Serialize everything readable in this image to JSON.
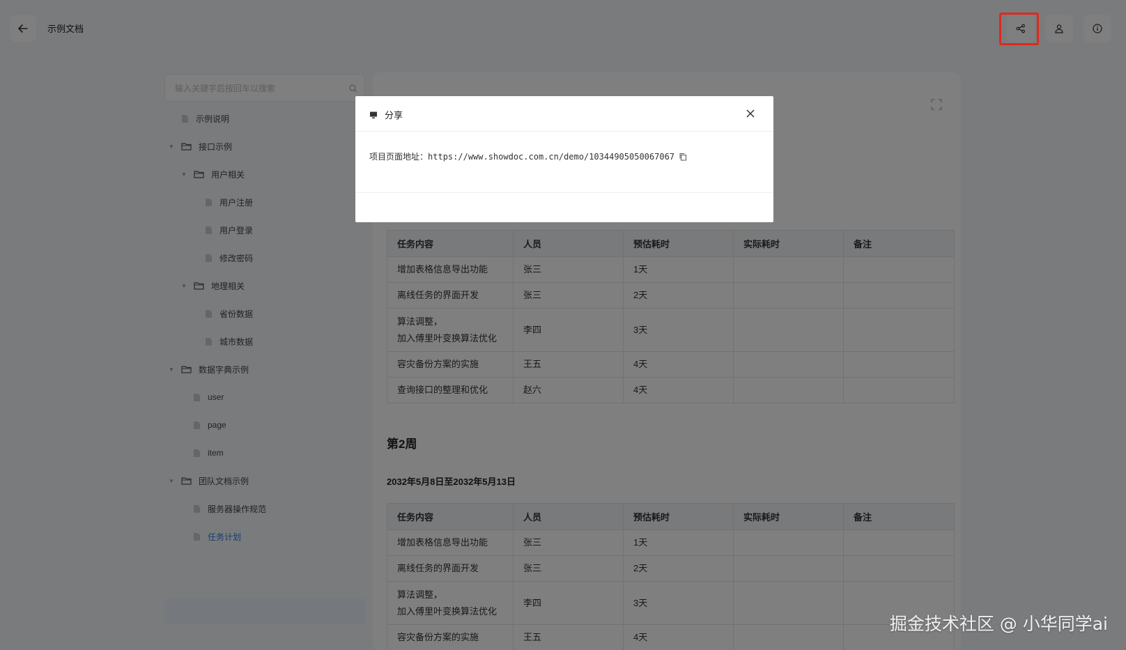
{
  "header": {
    "title": "示例文档",
    "back_icon": "arrow-left-icon",
    "share_icon": "share-icon",
    "user_icon": "user-icon",
    "info_icon": "info-icon"
  },
  "sidebar": {
    "search_placeholder": "输入关键字后按回车以搜索",
    "items": [
      {
        "label": "示例说明",
        "type": "file",
        "level": 0
      },
      {
        "label": "接口示例",
        "type": "folder",
        "level": 0,
        "expanded": true
      },
      {
        "label": "用户相关",
        "type": "folder",
        "level": 1,
        "expanded": true
      },
      {
        "label": "用户注册",
        "type": "file",
        "level": 2
      },
      {
        "label": "用户登录",
        "type": "file",
        "level": 2
      },
      {
        "label": "修改密码",
        "type": "file",
        "level": 2
      },
      {
        "label": "地理相关",
        "type": "folder",
        "level": 1,
        "expanded": true
      },
      {
        "label": "省份数据",
        "type": "file",
        "level": 2
      },
      {
        "label": "城市数据",
        "type": "file",
        "level": 2
      },
      {
        "label": "数据字典示例",
        "type": "folder",
        "level": 0,
        "expanded": true
      },
      {
        "label": "user",
        "type": "file",
        "level": 1
      },
      {
        "label": "page",
        "type": "file",
        "level": 1
      },
      {
        "label": "item",
        "type": "file",
        "level": 1
      },
      {
        "label": "团队文档示例",
        "type": "folder",
        "level": 0,
        "expanded": true
      },
      {
        "label": "服务器操作规范",
        "type": "file",
        "level": 1
      },
      {
        "label": "任务计划",
        "type": "file",
        "level": 1,
        "active": true
      }
    ]
  },
  "main": {
    "table_headers": [
      "任务内容",
      "人员",
      "预估耗时",
      "实际耗时",
      "备注"
    ],
    "week1_rows": [
      [
        "增加表格信息导出功能",
        "张三",
        "1天",
        "",
        ""
      ],
      [
        "离线任务的界面开发",
        "张三",
        "2天",
        "",
        ""
      ],
      [
        "算法调整，\n加入傅里叶变换算法优化",
        "李四",
        "3天",
        "",
        ""
      ],
      [
        "容灾备份方案的实施",
        "王五",
        "4天",
        "",
        ""
      ],
      [
        "查询接口的整理和优化",
        "赵六",
        "4天",
        "",
        ""
      ]
    ],
    "week2_heading": "第2周",
    "week2_range": "2032年5月8日至2032年5月13日",
    "week2_rows": [
      [
        "增加表格信息导出功能",
        "张三",
        "1天",
        "",
        ""
      ],
      [
        "离线任务的界面开发",
        "张三",
        "2天",
        "",
        ""
      ],
      [
        "算法调整，\n加入傅里叶变换算法优化",
        "李四",
        "3天",
        "",
        ""
      ],
      [
        "容灾备份方案的实施",
        "王五",
        "4天",
        "",
        ""
      ]
    ]
  },
  "modal": {
    "title": "分享",
    "url_label": "项目页面地址：",
    "url": "https://www.showdoc.com.cn/demo/10344905050067067"
  },
  "watermark": "掘金技术社区 @ 小华同学ai",
  "colors": {
    "accent": "#2a7ae2",
    "highlight": "#e0281e"
  }
}
